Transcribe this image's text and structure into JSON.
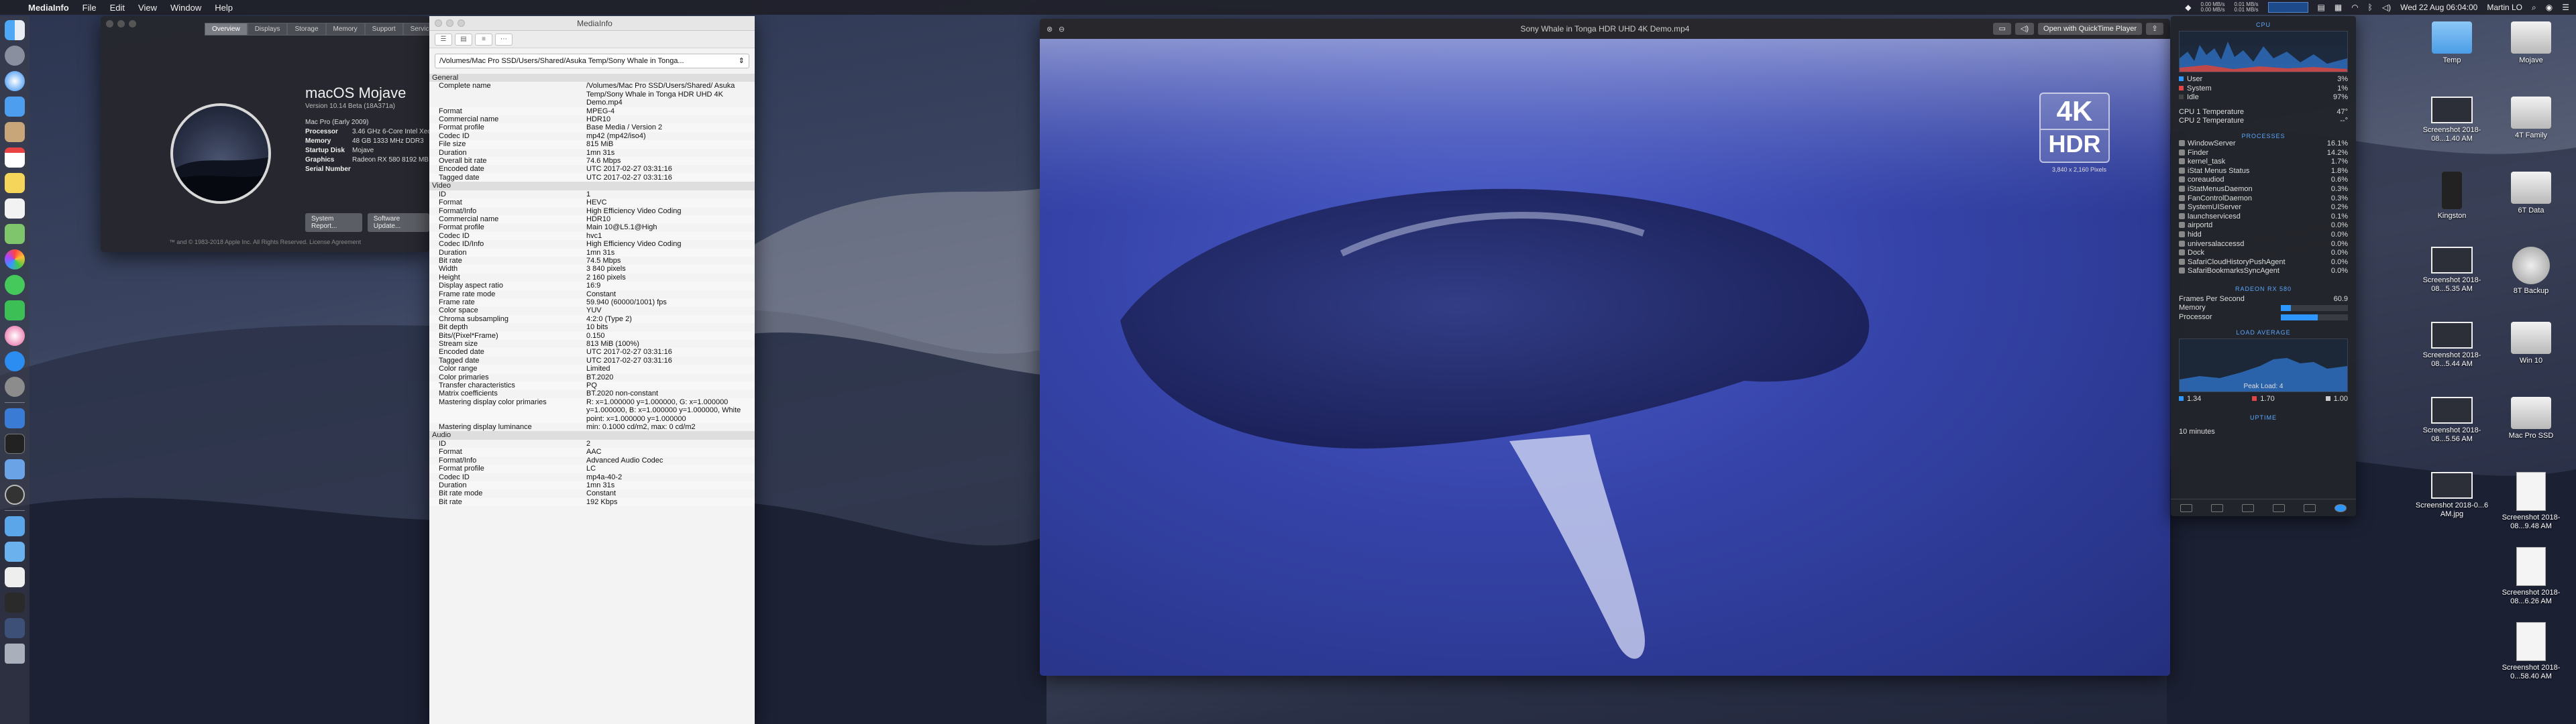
{
  "menubar": {
    "app": "MediaInfo",
    "menus": [
      "File",
      "Edit",
      "View",
      "Window",
      "Help"
    ],
    "network_up": "0.00 MB/s",
    "network_down": "0.00 MB/s",
    "disk_read": "0.01 MB/s",
    "disk_write": "0.01 MB/s",
    "clock": "Wed 22 Aug 06:04:00",
    "user": "Martin LO"
  },
  "about": {
    "tabs": [
      "Overview",
      "Displays",
      "Storage",
      "Memory",
      "Support",
      "Service"
    ],
    "os_name": "macOS Mojave",
    "version": "Version 10.14 Beta (18A371a)",
    "specs": [
      {
        "k": "",
        "v": "Mac Pro (Early 2009)"
      },
      {
        "k": "Processor",
        "v": "3.46 GHz 6-Core Intel Xeon"
      },
      {
        "k": "Memory",
        "v": "48 GB 1333 MHz DDR3"
      },
      {
        "k": "Startup Disk",
        "v": "Mojave"
      },
      {
        "k": "Graphics",
        "v": "Radeon RX 580 8192 MB"
      },
      {
        "k": "Serial Number",
        "v": ""
      }
    ],
    "btn_report": "System Report...",
    "btn_update": "Software Update...",
    "footer": "™ and © 1983-2018 Apple Inc. All Rights Reserved. License Agreement"
  },
  "mediainfo": {
    "title": "MediaInfo",
    "path": "/Volumes/Mac Pro SSD/Users/Shared/Asuka Temp/Sony Whale in Tonga...",
    "sections": [
      {
        "name": "General",
        "rows": [
          [
            "Complete name",
            "/Volumes/Mac Pro SSD/Users/Shared/ Asuka Temp/Sony Whale in Tonga HDR UHD 4K Demo.mp4"
          ],
          [
            "Format",
            "MPEG-4"
          ],
          [
            "Commercial name",
            "HDR10"
          ],
          [
            "Format profile",
            "Base Media / Version 2"
          ],
          [
            "Codec ID",
            "mp42 (mp42/iso4)"
          ],
          [
            "File size",
            "815 MiB"
          ],
          [
            "Duration",
            "1mn 31s"
          ],
          [
            "Overall bit rate",
            "74.6 Mbps"
          ],
          [
            "Encoded date",
            "UTC 2017-02-27 03:31:16"
          ],
          [
            "Tagged date",
            "UTC 2017-02-27 03:31:16"
          ]
        ]
      },
      {
        "name": "Video",
        "rows": [
          [
            "ID",
            "1"
          ],
          [
            "Format",
            "HEVC"
          ],
          [
            "Format/Info",
            "High Efficiency Video Coding"
          ],
          [
            "Commercial name",
            "HDR10"
          ],
          [
            "Format profile",
            "Main 10@L5.1@High"
          ],
          [
            "Codec ID",
            "hvc1"
          ],
          [
            "Codec ID/Info",
            "High Efficiency Video Coding"
          ],
          [
            "Duration",
            "1mn 31s"
          ],
          [
            "Bit rate",
            "74.5 Mbps"
          ],
          [
            "Width",
            "3 840 pixels"
          ],
          [
            "Height",
            "2 160 pixels"
          ],
          [
            "Display aspect ratio",
            "16:9"
          ],
          [
            "Frame rate mode",
            "Constant"
          ],
          [
            "Frame rate",
            "59.940 (60000/1001) fps"
          ],
          [
            "Color space",
            "YUV"
          ],
          [
            "Chroma subsampling",
            "4:2:0 (Type 2)"
          ],
          [
            "Bit depth",
            "10 bits"
          ],
          [
            "Bits/(Pixel*Frame)",
            "0.150"
          ],
          [
            "Stream size",
            "813 MiB (100%)"
          ],
          [
            "Encoded date",
            "UTC 2017-02-27 03:31:16"
          ],
          [
            "Tagged date",
            "UTC 2017-02-27 03:31:16"
          ],
          [
            "Color range",
            "Limited"
          ],
          [
            "Color primaries",
            "BT.2020"
          ],
          [
            "Transfer characteristics",
            "PQ"
          ],
          [
            "Matrix coefficients",
            "BT.2020 non-constant"
          ],
          [
            "Mastering display color primaries",
            "R: x=1.000000 y=1.000000, G: x=1.000000 y=1.000000, B: x=1.000000 y=1.000000, White point: x=1.000000 y=1.000000"
          ],
          [
            "Mastering display luminance",
            "min: 0.1000 cd/m2, max: 0 cd/m2"
          ]
        ]
      },
      {
        "name": "Audio",
        "rows": [
          [
            "ID",
            "2"
          ],
          [
            "Format",
            "AAC"
          ],
          [
            "Format/Info",
            "Advanced Audio Codec"
          ],
          [
            "Format profile",
            "LC"
          ],
          [
            "Codec ID",
            "mp4a-40-2"
          ],
          [
            "Duration",
            "1mn 31s"
          ],
          [
            "Bit rate mode",
            "Constant"
          ],
          [
            "Bit rate",
            "192 Kbps"
          ]
        ]
      }
    ]
  },
  "quicktime": {
    "title": "Sony Whale in Tonga HDR UHD 4K Demo.mp4",
    "open_btn": "Open with QuickTime Player",
    "badge_top": "4K",
    "badge_bottom": "HDR",
    "badge_res": "3,840 x 2,160 Pixels"
  },
  "istat": {
    "cpu_head": "CPU",
    "cpu_rows": [
      {
        "k": "User",
        "v": "3%",
        "color": "#2e97ff"
      },
      {
        "k": "System",
        "v": "1%",
        "color": "#e04646"
      },
      {
        "k": "Idle",
        "v": "97%",
        "color": "#444"
      }
    ],
    "temps": [
      {
        "k": "CPU 1 Temperature",
        "v": "47°"
      },
      {
        "k": "CPU 2 Temperature",
        "v": "--°"
      }
    ],
    "proc_head": "PROCESSES",
    "processes": [
      {
        "k": "WindowServer",
        "v": "16.1%"
      },
      {
        "k": "Finder",
        "v": "14.2%"
      },
      {
        "k": "kernel_task",
        "v": "1.7%"
      },
      {
        "k": "iStat Menus Status",
        "v": "1.8%"
      },
      {
        "k": "coreaudiod",
        "v": "0.6%"
      },
      {
        "k": "iStatMenusDaemon",
        "v": "0.3%"
      },
      {
        "k": "FanControlDaemon",
        "v": "0.3%"
      },
      {
        "k": "SystemUIServer",
        "v": "0.2%"
      },
      {
        "k": "launchservicesd",
        "v": "0.1%"
      },
      {
        "k": "airportd",
        "v": "0.0%"
      },
      {
        "k": "hidd",
        "v": "0.0%"
      },
      {
        "k": "universalaccessd",
        "v": "0.0%"
      },
      {
        "k": "Dock",
        "v": "0.0%"
      },
      {
        "k": "SafariCloudHistoryPushAgent",
        "v": "0.0%"
      },
      {
        "k": "SafariBookmarksSyncAgent",
        "v": "0.0%"
      }
    ],
    "gpu_head": "RADEON RX 580",
    "fps_label": "Frames Per Second",
    "fps_value": "60.9",
    "gpu_memory_label": "Memory",
    "gpu_memory_level": 0.15,
    "gpu_processor_label": "Processor",
    "gpu_processor_level": 0.55,
    "load_head": "LOAD AVERAGE",
    "peak_load": "Peak Load: 4",
    "loads": [
      {
        "v": "1.34",
        "color": "#2e97ff"
      },
      {
        "v": "1.70",
        "color": "#e04646"
      },
      {
        "v": "1.00",
        "color": "#cccccc"
      }
    ],
    "uptime_head": "UPTIME",
    "uptime": "10 minutes"
  },
  "desktop": [
    {
      "label": "Temp",
      "kind": "folder"
    },
    {
      "label": "Mojave",
      "kind": "drive"
    },
    {
      "label": "Screenshot 2018-08...1.40 AM",
      "kind": "shot"
    },
    {
      "label": "4T Family",
      "kind": "drive"
    },
    {
      "label": "Kingston",
      "kind": "usb"
    },
    {
      "label": "6T Data",
      "kind": "drive"
    },
    {
      "label": "Screenshot 2018-08...5.35 AM",
      "kind": "shot"
    },
    {
      "label": "8T Backup",
      "kind": "backup"
    },
    {
      "label": "Screenshot 2018-08...5.44 AM",
      "kind": "shot"
    },
    {
      "label": "Win 10",
      "kind": "drive"
    },
    {
      "label": "Screenshot 2018-08...5.56 AM",
      "kind": "shot"
    },
    {
      "label": "Mac Pro SSD",
      "kind": "drive"
    },
    {
      "label": "Screenshot 2018-0...6 AM.jpg",
      "kind": "shot"
    },
    {
      "label": "Screenshot 2018-08...9.48 AM",
      "kind": "doc"
    },
    {
      "label": "Screenshot 2018-08...6.26 AM",
      "kind": "doc"
    },
    {
      "label": "Screenshot 2018-0...58.40 AM",
      "kind": "doc"
    }
  ]
}
